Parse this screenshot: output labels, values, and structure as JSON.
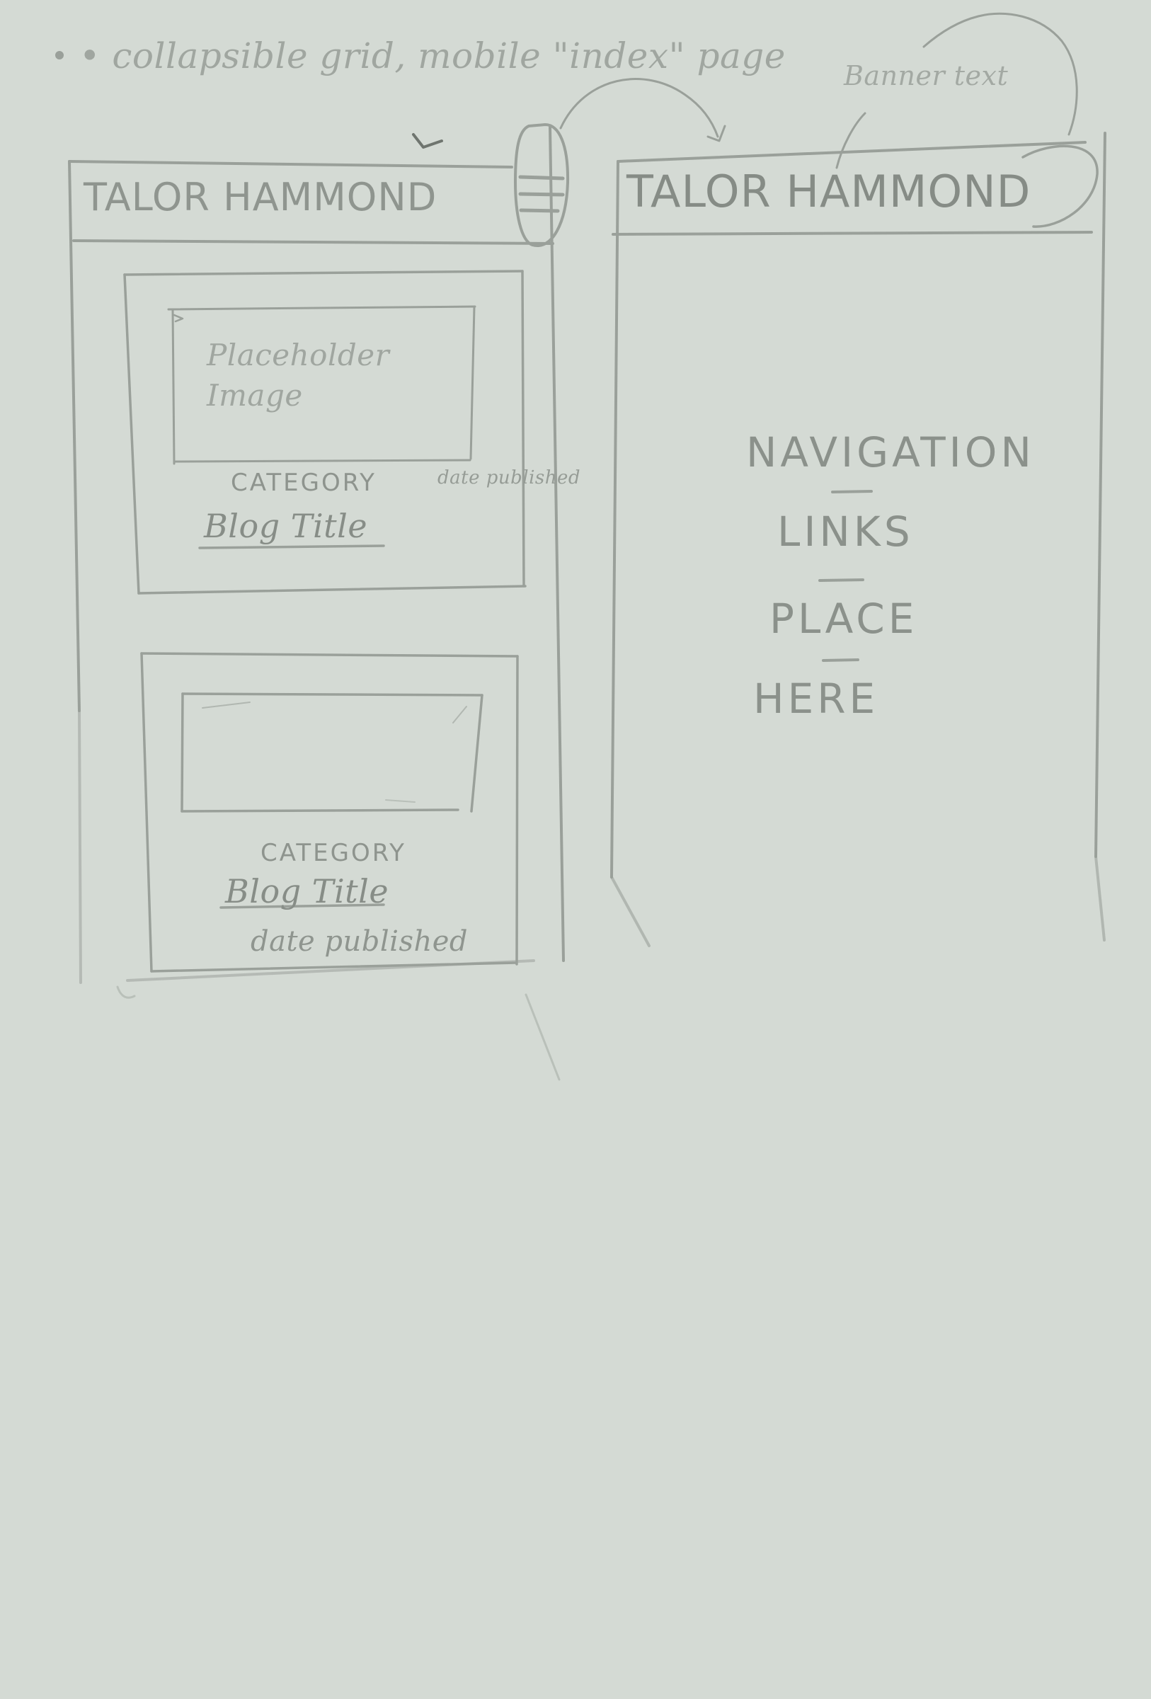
{
  "notes": {
    "top_note": "• collapsible grid, mobile \"index\" page",
    "small_note": "Banner text"
  },
  "left_screen": {
    "brand": "TALOR HAMMOND",
    "cards": [
      {
        "placeholder": "Placeholder\nImage",
        "category": "CATEGORY",
        "title": "Blog Title",
        "date": "date published"
      },
      {
        "category": "CATEGORY",
        "title": "Blog Title",
        "date": "date published"
      }
    ],
    "icons": {
      "menu": "hamburger-menu-icon",
      "checkmark": "checkmark-icon"
    }
  },
  "right_screen": {
    "brand": "TALOR HAMMOND",
    "nav_links": [
      "NAVIGATION",
      "LINKS",
      "PLACE",
      "HERE"
    ],
    "icons": {
      "close": "close-icon"
    }
  },
  "colors": {
    "paper": "#d4dad4",
    "pencil": "#8b918b"
  }
}
